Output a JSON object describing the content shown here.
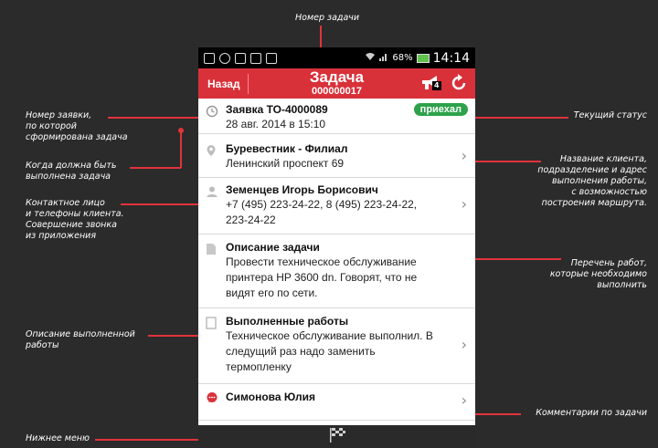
{
  "annotations": {
    "task_number": "Номер задачи",
    "request_number": [
      "Номер заявки,",
      "по которой",
      "сформирована задача"
    ],
    "due_time": [
      "Когда должна быть",
      "выполнена задача"
    ],
    "contact": [
      "Контактное лицо",
      "и телефоны клиента.",
      "Совершение звонка",
      "из приложения"
    ],
    "done_description": [
      "Описание выполненной",
      "работы"
    ],
    "bottom_menu": "Нижнее меню",
    "current_status": "Текущий статус",
    "client_name": [
      "Название клиента,",
      "подразделение и адрес",
      "выполнения работы,",
      "с возможностью",
      "построения маршрута."
    ],
    "work_list": [
      "Перечень работ,",
      "которые необходимо",
      "выполнить"
    ],
    "comments": "Комментарии по задачи"
  },
  "statusbar": {
    "signal": "68%",
    "time": "14:14"
  },
  "appbar": {
    "back": "Назад",
    "title": "Задача",
    "subtitle": "000000017",
    "badge": "4"
  },
  "rows": {
    "request": {
      "title": "Заявка ТО-4000089",
      "date": "28 авг. 2014 в 15:10",
      "status": "приехал"
    },
    "client": {
      "title": "Буревестник - Филиал",
      "address": "Ленинский проспект 69"
    },
    "contact": {
      "name": "Земенцев Игорь Борисович",
      "phones": [
        "+7 (495) 223-24-22, 8 (495) 223-24-22,",
        "223-24-22"
      ]
    },
    "task": {
      "title": "Описание задачи",
      "lines": [
        "Провести техническое обслуживание",
        "принтера HP 3600 dn. Говорят, что не",
        "видят его по сети."
      ]
    },
    "done": {
      "title": "Выполненные работы",
      "lines": [
        "Техническое обслуживание выполнил. В",
        "следущий раз надо заменить",
        "термопленку"
      ]
    },
    "comment": {
      "author": "Симонова Юлия"
    }
  },
  "colors": {
    "accent": "#d8313a",
    "status": "#2da24a",
    "annotation_line": "#e2333b"
  }
}
